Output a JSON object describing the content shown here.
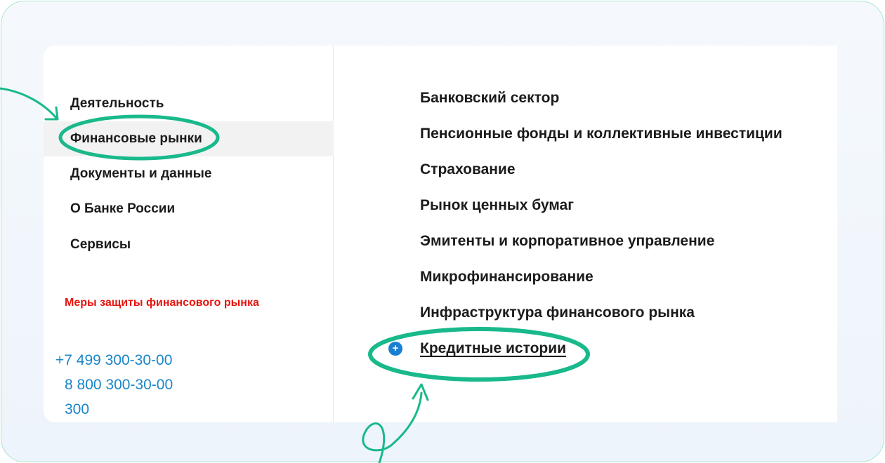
{
  "sidebar": {
    "items": [
      {
        "label": "Деятельность",
        "active": false
      },
      {
        "label": "Финансовые рынки",
        "active": true
      },
      {
        "label": "Документы и данные",
        "active": false
      },
      {
        "label": "О Банке России",
        "active": false
      },
      {
        "label": "Сервисы",
        "active": false
      }
    ],
    "protection_link": "Меры защиты финансового рынка",
    "phones": [
      "+7 499 300-30-00",
      "8 800 300-30-00",
      "300"
    ]
  },
  "submenu": {
    "items": [
      {
        "label": "Банковский сектор"
      },
      {
        "label": "Пенсионные фонды и коллективные инвестиции"
      },
      {
        "label": "Страхование"
      },
      {
        "label": "Рынок ценных бумаг"
      },
      {
        "label": "Эмитенты и корпоративное управление"
      },
      {
        "label": "Микрофинансирование"
      },
      {
        "label": "Инфраструктура финансового рынка"
      },
      {
        "label": "Кредитные истории",
        "current": true
      }
    ],
    "expand_icon": "plus-icon"
  },
  "colors": {
    "highlight": "#19b98b",
    "warning_link": "#e8150f",
    "phone_link": "#1a86c8",
    "expand_icon": "#1a7fd0"
  }
}
